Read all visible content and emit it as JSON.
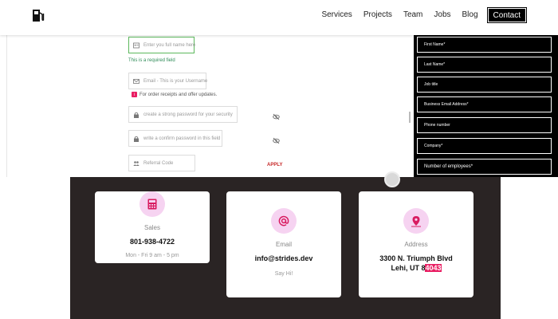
{
  "nav": {
    "logo_icon": "fuel-pump-icon",
    "links": [
      "Services",
      "Projects",
      "Team",
      "Jobs",
      "Blog"
    ],
    "contact_label": "Contact"
  },
  "form": {
    "full_name_placeholder": "Enter you full name here",
    "required_note": "This is a required field",
    "email_placeholder": "Email - This is your Username",
    "email_note": "For order receipts and offer updates.",
    "password_placeholder": "create a strong password for your security",
    "confirm_placeholder": "write a confirm password in this field",
    "referral_placeholder": "Referral Code",
    "apply_label": "APPLY"
  },
  "side_form": {
    "fields": [
      "First Name*",
      "Last Name*",
      "Job title",
      "Business Email Address*",
      "Phone number",
      "Company*",
      "Number of employees*"
    ]
  },
  "contact": {
    "cards": [
      {
        "icon": "calculator-icon",
        "label": "Sales",
        "value": "801-938-4722",
        "sub": "Mon - Fri 9 am - 5 pm"
      },
      {
        "icon": "at-sign-icon",
        "label": "Email",
        "value": "info@strides.dev",
        "sub": "Say Hi!"
      },
      {
        "icon": "map-pin-icon",
        "label": "Address",
        "value_line1": "3300 N. Triumph Blvd",
        "value_line2_plain": "Lehi, UT 8",
        "value_line2_highlight": "4043"
      }
    ]
  },
  "colors": {
    "accent": "#e91e63",
    "icon_bg": "#f6d3f1",
    "dark_section": "#2a2424",
    "valid_green": "#2e8b57"
  }
}
